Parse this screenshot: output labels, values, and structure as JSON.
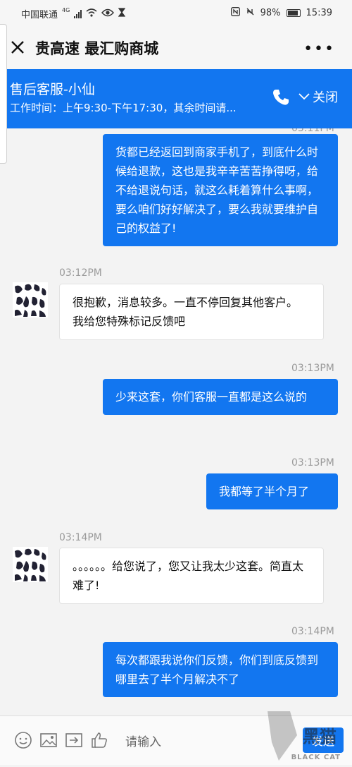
{
  "status_bar": {
    "carrier": "中国联通",
    "network": "4G",
    "battery": "98%",
    "time": "15:39"
  },
  "header": {
    "title": "贵高速 最汇购商城"
  },
  "agent_banner": {
    "name": "售后客服-小仙",
    "hours": "工作时间：上午9:30-下午17:30，其余时间请...",
    "collapse_label": "关闭"
  },
  "messages": [
    {
      "text": "货都已经返回到商家手机了，到底什么时候给退款，这也是我辛辛苦苦挣得呀，给不给退说句话，就这么耗着算什么事啊，要么咱们好好解决了，要么我就要维护自己的权益了!"
    },
    {
      "time": "03:12PM",
      "text": "很抱歉，消息较多。一直不停回复其他客户。 我给您特殊标记反馈吧"
    },
    {
      "time": "03:13PM",
      "text": "少来这套，你们客服一直都是这么说的"
    },
    {
      "time": "03:13PM",
      "text": "我都等了半个月了"
    },
    {
      "time": "03:14PM",
      "text": "。。。。。。给您说了，您又让我太少这套。简直太难了!"
    },
    {
      "time": "03:14PM",
      "text": "每次都跟我说你们反馈，你们到底反馈到哪里去了半个月解决不了"
    }
  ],
  "input_bar": {
    "placeholder": "请输入",
    "send_label": "发送"
  },
  "watermark": {
    "text": "BLACK CAT"
  },
  "colors": {
    "accent": "#1276f0",
    "background": "#f3f3f3"
  }
}
